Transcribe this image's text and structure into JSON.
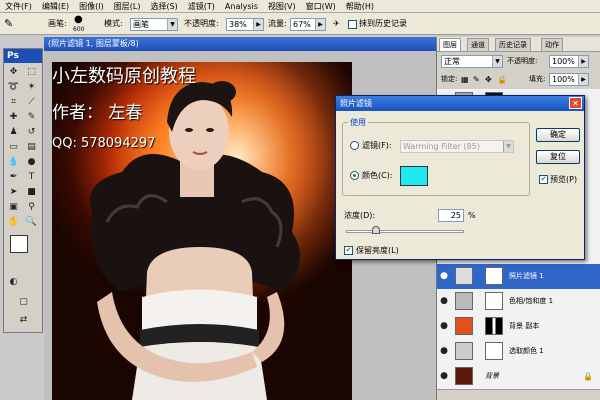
{
  "menu": [
    "文件(F)",
    "编辑(E)",
    "图像(I)",
    "图层(L)",
    "选择(S)",
    "滤镜(T)",
    "Analysis",
    "视图(V)",
    "窗口(W)",
    "帮助(H)"
  ],
  "options": {
    "brush_label": "画笔:",
    "brush_size": "600",
    "mode_label": "模式:",
    "mode_value": "画笔",
    "opacity_label": "不透明度:",
    "opacity_value": "38%",
    "flow_label": "流量:",
    "flow_value": "67%",
    "history_label": "抹到历史记录"
  },
  "doc": {
    "title": "(照片滤镜 1, 图层蒙板/8)",
    "watermark_1": "小左数码原创教程",
    "watermark_2": "作者：  左春",
    "watermark_3": "QQ:  578094297"
  },
  "layers": {
    "tabs": [
      "图层",
      "通道",
      "历史记录",
      "动作"
    ],
    "blend_mode": "正常",
    "opacity_label": "不透明度:",
    "opacity_value": "100%",
    "lock_label": "锁定:",
    "fill_label": "填充:",
    "fill_value": "100%",
    "items": [
      {
        "name": "照片滤镜 1",
        "selected": true
      },
      {
        "name": "色相/饱和度 1",
        "selected": false
      },
      {
        "name": "背景 副本",
        "selected": false
      },
      {
        "name": "选取颜色 1",
        "selected": false
      },
      {
        "name": "背景",
        "selected": false
      }
    ]
  },
  "dialog": {
    "title": "照片滤镜",
    "use_label": "使用",
    "filter_label": "滤镜(F):",
    "filter_value": "Warming Filter (85)",
    "color_label": "颜色(C):",
    "color_swatch": "#1fe8f0",
    "density_label": "浓度(D):",
    "density_value": "25",
    "density_unit": "%",
    "density_level": 25,
    "preserve_label": "保留亮度(L)",
    "ok_label": "确定",
    "cancel_label": "复位",
    "preview_label": "预览(P)"
  }
}
